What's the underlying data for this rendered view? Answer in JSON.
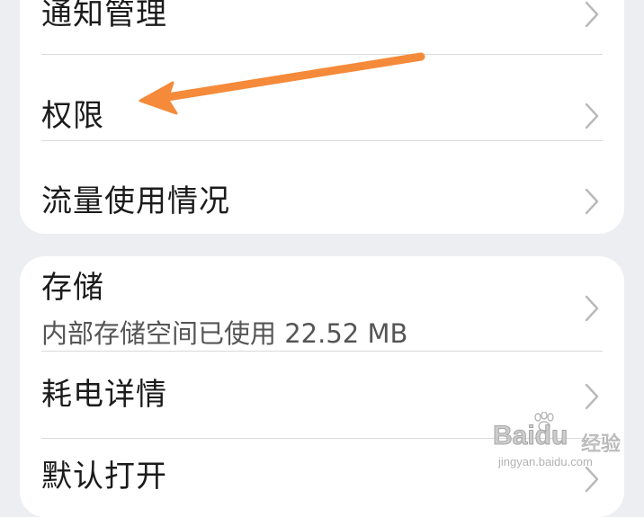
{
  "card_apps": {
    "items": [
      {
        "label": "通知管理"
      },
      {
        "label": "权限"
      },
      {
        "label": "流量使用情况"
      }
    ]
  },
  "card_storage": {
    "items": [
      {
        "label": "存储",
        "subtitle": "内部存储空间已使用 22.52 MB"
      },
      {
        "label": "耗电详情"
      },
      {
        "label": "默认打开"
      }
    ]
  },
  "annotation": {
    "arrow_color": "#f58a3a",
    "points_to": "权限"
  },
  "icons": {
    "row_chevron": "chevron-right-icon"
  },
  "watermark": {
    "logo": "Baidu",
    "suffix": "经验",
    "url": "jingyan.baidu.com"
  }
}
